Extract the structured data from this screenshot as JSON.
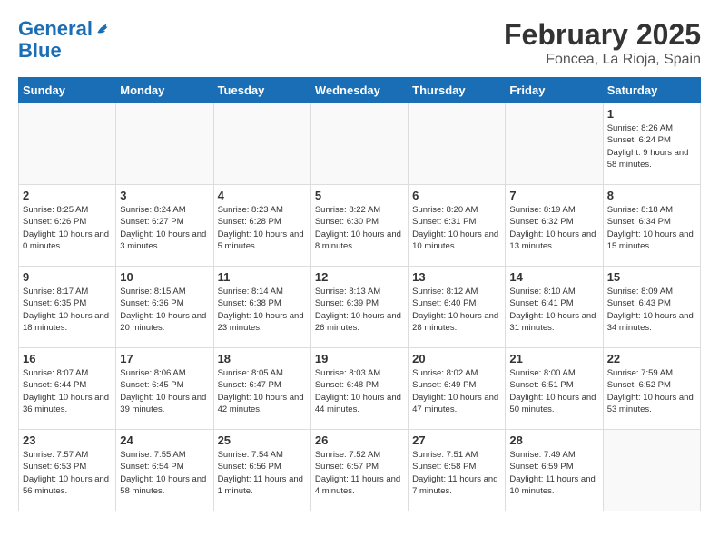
{
  "header": {
    "logo_line1": "General",
    "logo_line2": "Blue",
    "month_year": "February 2025",
    "location": "Foncea, La Rioja, Spain"
  },
  "weekdays": [
    "Sunday",
    "Monday",
    "Tuesday",
    "Wednesday",
    "Thursday",
    "Friday",
    "Saturday"
  ],
  "weeks": [
    [
      {
        "day": "",
        "info": ""
      },
      {
        "day": "",
        "info": ""
      },
      {
        "day": "",
        "info": ""
      },
      {
        "day": "",
        "info": ""
      },
      {
        "day": "",
        "info": ""
      },
      {
        "day": "",
        "info": ""
      },
      {
        "day": "1",
        "info": "Sunrise: 8:26 AM\nSunset: 6:24 PM\nDaylight: 9 hours and 58 minutes."
      }
    ],
    [
      {
        "day": "2",
        "info": "Sunrise: 8:25 AM\nSunset: 6:26 PM\nDaylight: 10 hours and 0 minutes."
      },
      {
        "day": "3",
        "info": "Sunrise: 8:24 AM\nSunset: 6:27 PM\nDaylight: 10 hours and 3 minutes."
      },
      {
        "day": "4",
        "info": "Sunrise: 8:23 AM\nSunset: 6:28 PM\nDaylight: 10 hours and 5 minutes."
      },
      {
        "day": "5",
        "info": "Sunrise: 8:22 AM\nSunset: 6:30 PM\nDaylight: 10 hours and 8 minutes."
      },
      {
        "day": "6",
        "info": "Sunrise: 8:20 AM\nSunset: 6:31 PM\nDaylight: 10 hours and 10 minutes."
      },
      {
        "day": "7",
        "info": "Sunrise: 8:19 AM\nSunset: 6:32 PM\nDaylight: 10 hours and 13 minutes."
      },
      {
        "day": "8",
        "info": "Sunrise: 8:18 AM\nSunset: 6:34 PM\nDaylight: 10 hours and 15 minutes."
      }
    ],
    [
      {
        "day": "9",
        "info": "Sunrise: 8:17 AM\nSunset: 6:35 PM\nDaylight: 10 hours and 18 minutes."
      },
      {
        "day": "10",
        "info": "Sunrise: 8:15 AM\nSunset: 6:36 PM\nDaylight: 10 hours and 20 minutes."
      },
      {
        "day": "11",
        "info": "Sunrise: 8:14 AM\nSunset: 6:38 PM\nDaylight: 10 hours and 23 minutes."
      },
      {
        "day": "12",
        "info": "Sunrise: 8:13 AM\nSunset: 6:39 PM\nDaylight: 10 hours and 26 minutes."
      },
      {
        "day": "13",
        "info": "Sunrise: 8:12 AM\nSunset: 6:40 PM\nDaylight: 10 hours and 28 minutes."
      },
      {
        "day": "14",
        "info": "Sunrise: 8:10 AM\nSunset: 6:41 PM\nDaylight: 10 hours and 31 minutes."
      },
      {
        "day": "15",
        "info": "Sunrise: 8:09 AM\nSunset: 6:43 PM\nDaylight: 10 hours and 34 minutes."
      }
    ],
    [
      {
        "day": "16",
        "info": "Sunrise: 8:07 AM\nSunset: 6:44 PM\nDaylight: 10 hours and 36 minutes."
      },
      {
        "day": "17",
        "info": "Sunrise: 8:06 AM\nSunset: 6:45 PM\nDaylight: 10 hours and 39 minutes."
      },
      {
        "day": "18",
        "info": "Sunrise: 8:05 AM\nSunset: 6:47 PM\nDaylight: 10 hours and 42 minutes."
      },
      {
        "day": "19",
        "info": "Sunrise: 8:03 AM\nSunset: 6:48 PM\nDaylight: 10 hours and 44 minutes."
      },
      {
        "day": "20",
        "info": "Sunrise: 8:02 AM\nSunset: 6:49 PM\nDaylight: 10 hours and 47 minutes."
      },
      {
        "day": "21",
        "info": "Sunrise: 8:00 AM\nSunset: 6:51 PM\nDaylight: 10 hours and 50 minutes."
      },
      {
        "day": "22",
        "info": "Sunrise: 7:59 AM\nSunset: 6:52 PM\nDaylight: 10 hours and 53 minutes."
      }
    ],
    [
      {
        "day": "23",
        "info": "Sunrise: 7:57 AM\nSunset: 6:53 PM\nDaylight: 10 hours and 56 minutes."
      },
      {
        "day": "24",
        "info": "Sunrise: 7:55 AM\nSunset: 6:54 PM\nDaylight: 10 hours and 58 minutes."
      },
      {
        "day": "25",
        "info": "Sunrise: 7:54 AM\nSunset: 6:56 PM\nDaylight: 11 hours and 1 minute."
      },
      {
        "day": "26",
        "info": "Sunrise: 7:52 AM\nSunset: 6:57 PM\nDaylight: 11 hours and 4 minutes."
      },
      {
        "day": "27",
        "info": "Sunrise: 7:51 AM\nSunset: 6:58 PM\nDaylight: 11 hours and 7 minutes."
      },
      {
        "day": "28",
        "info": "Sunrise: 7:49 AM\nSunset: 6:59 PM\nDaylight: 11 hours and 10 minutes."
      },
      {
        "day": "",
        "info": ""
      }
    ]
  ]
}
